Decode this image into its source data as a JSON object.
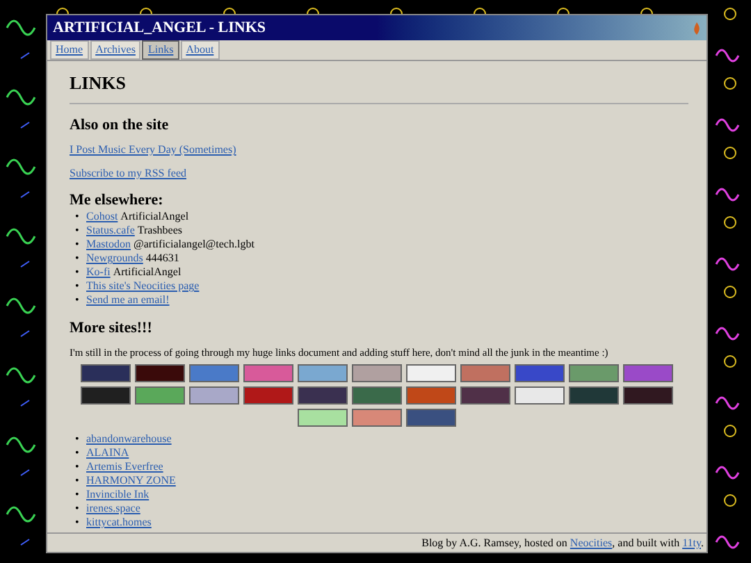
{
  "window": {
    "title": "ARTIFICIAL_ANGEL - LINKS"
  },
  "tabs": [
    {
      "label": "Home",
      "selected": false
    },
    {
      "label": "Archives",
      "selected": false
    },
    {
      "label": "Links",
      "selected": true
    },
    {
      "label": "About",
      "selected": false
    }
  ],
  "page_title": "LINKS",
  "also_on_site": {
    "heading": "Also on the site",
    "links": [
      "I Post Music Every Day (Sometimes)",
      "Subscribe to my RSS feed"
    ]
  },
  "elsewhere": {
    "heading": "Me elsewhere:",
    "items": [
      {
        "bullet": "•",
        "link": "Cohost",
        "handle": "ArtificialAngel"
      },
      {
        "bullet": "•",
        "link": "Status.cafe",
        "handle": "Trashbees"
      },
      {
        "bullet": "•",
        "link": "Mastodon",
        "handle": "@artificialangel@tech.lgbt"
      },
      {
        "bullet": "•",
        "link": "Newgrounds",
        "handle": "444631"
      },
      {
        "bullet": "•",
        "link": "Ko-fi",
        "handle": "ArtificialAngel"
      },
      {
        "bullet": "•",
        "link": "This site's Neocities page"
      },
      {
        "bullet": "•",
        "link": "Send me an email!"
      }
    ]
  },
  "more_sites": {
    "heading": "More sites!!!",
    "intro": "I'm still in the process of going through my huge links document and adding stuff here, don't mind all the junk in the meantime :)",
    "badges": [
      {
        "color": "#2a2f5a"
      },
      {
        "color": "#3a0a0a"
      },
      {
        "color": "#4a7ac8"
      },
      {
        "color": "#d85a9a"
      },
      {
        "color": "#7aa8d0"
      },
      {
        "color": "#b0a0a0"
      },
      {
        "color": "#f0f0f0"
      },
      {
        "color": "#c07060"
      },
      {
        "color": "#3848c8"
      },
      {
        "color": "#6a9a6a"
      },
      {
        "color": "#9a4ac8"
      },
      {
        "color": "#202020"
      },
      {
        "color": "#5aa85a"
      },
      {
        "color": "#a8a8c8"
      },
      {
        "color": "#b01818"
      },
      {
        "color": "#3a3050"
      },
      {
        "color": "#3a6a4a"
      },
      {
        "color": "#c04818"
      },
      {
        "color": "#503048"
      },
      {
        "color": "#e8e8e8"
      },
      {
        "color": "#203838"
      },
      {
        "color": "#301820"
      },
      {
        "color": "#a8e0a0"
      },
      {
        "color": "#d88878"
      },
      {
        "color": "#3a5080"
      }
    ],
    "links": [
      {
        "bullet": "•",
        "text": "abandonwarehouse"
      },
      {
        "bullet": "•",
        "text": "ALAINA"
      },
      {
        "bullet": "•",
        "text": "Artemis Everfree"
      },
      {
        "bullet": "•",
        "text": "HARMONY ZONE"
      },
      {
        "bullet": "•",
        "text": "Invincible Ink"
      },
      {
        "bullet": "•",
        "text": "irenes.space"
      },
      {
        "bullet": "•",
        "text": "kittycat.homes"
      }
    ]
  },
  "footer": {
    "parts": [
      {
        "kind": "text",
        "text": "Blog by A.G. Ramsey, hosted on "
      },
      {
        "kind": "link",
        "text": "Neocities"
      },
      {
        "kind": "text",
        "text": ", and built with "
      },
      {
        "kind": "link",
        "text": "11ty"
      },
      {
        "kind": "text",
        "text": "."
      }
    ]
  }
}
